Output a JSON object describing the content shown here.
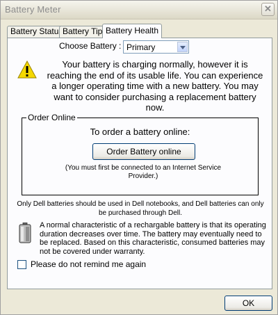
{
  "window": {
    "title": "Battery Meter",
    "close_symbol": "✕"
  },
  "tabs": [
    {
      "label": "Battery Status",
      "active": false
    },
    {
      "label": "Battery Tips",
      "active": false
    },
    {
      "label": "Battery Health",
      "active": true
    }
  ],
  "choose_battery": {
    "label": "Choose Battery :",
    "selected": "Primary"
  },
  "warning": {
    "icon": "warning-icon",
    "text": "Your battery is charging normally, however it is reaching the end of its usable life. You can experience a longer operating time with a new battery. You may want to consider purchasing a replacement battery now."
  },
  "order_online": {
    "legend": "Order Online",
    "title": "To order a battery online:",
    "button_label": "Order Battery online",
    "note": "(You must first be connected to an Internet Service Provider.)"
  },
  "dell_note": "Only Dell batteries should be used in Dell notebooks, and Dell batteries can only be purchased through Dell.",
  "battery_info": {
    "icon": "battery-icon",
    "text": "A normal characteristic of a rechargable battery is that its operating duration decreases over time.  The battery may eventually need to be replaced. Based on this characteristic, consumed batteries may not be covered under warranty."
  },
  "remind_checkbox": {
    "label": "Please do not remind me again",
    "checked": false
  },
  "ok_label": "OK",
  "colors": {
    "window_bg": "#ECE9D8",
    "panel_bg": "#FCFCFE",
    "warning_yellow": "#F5D800",
    "button_border": "#003C74"
  }
}
